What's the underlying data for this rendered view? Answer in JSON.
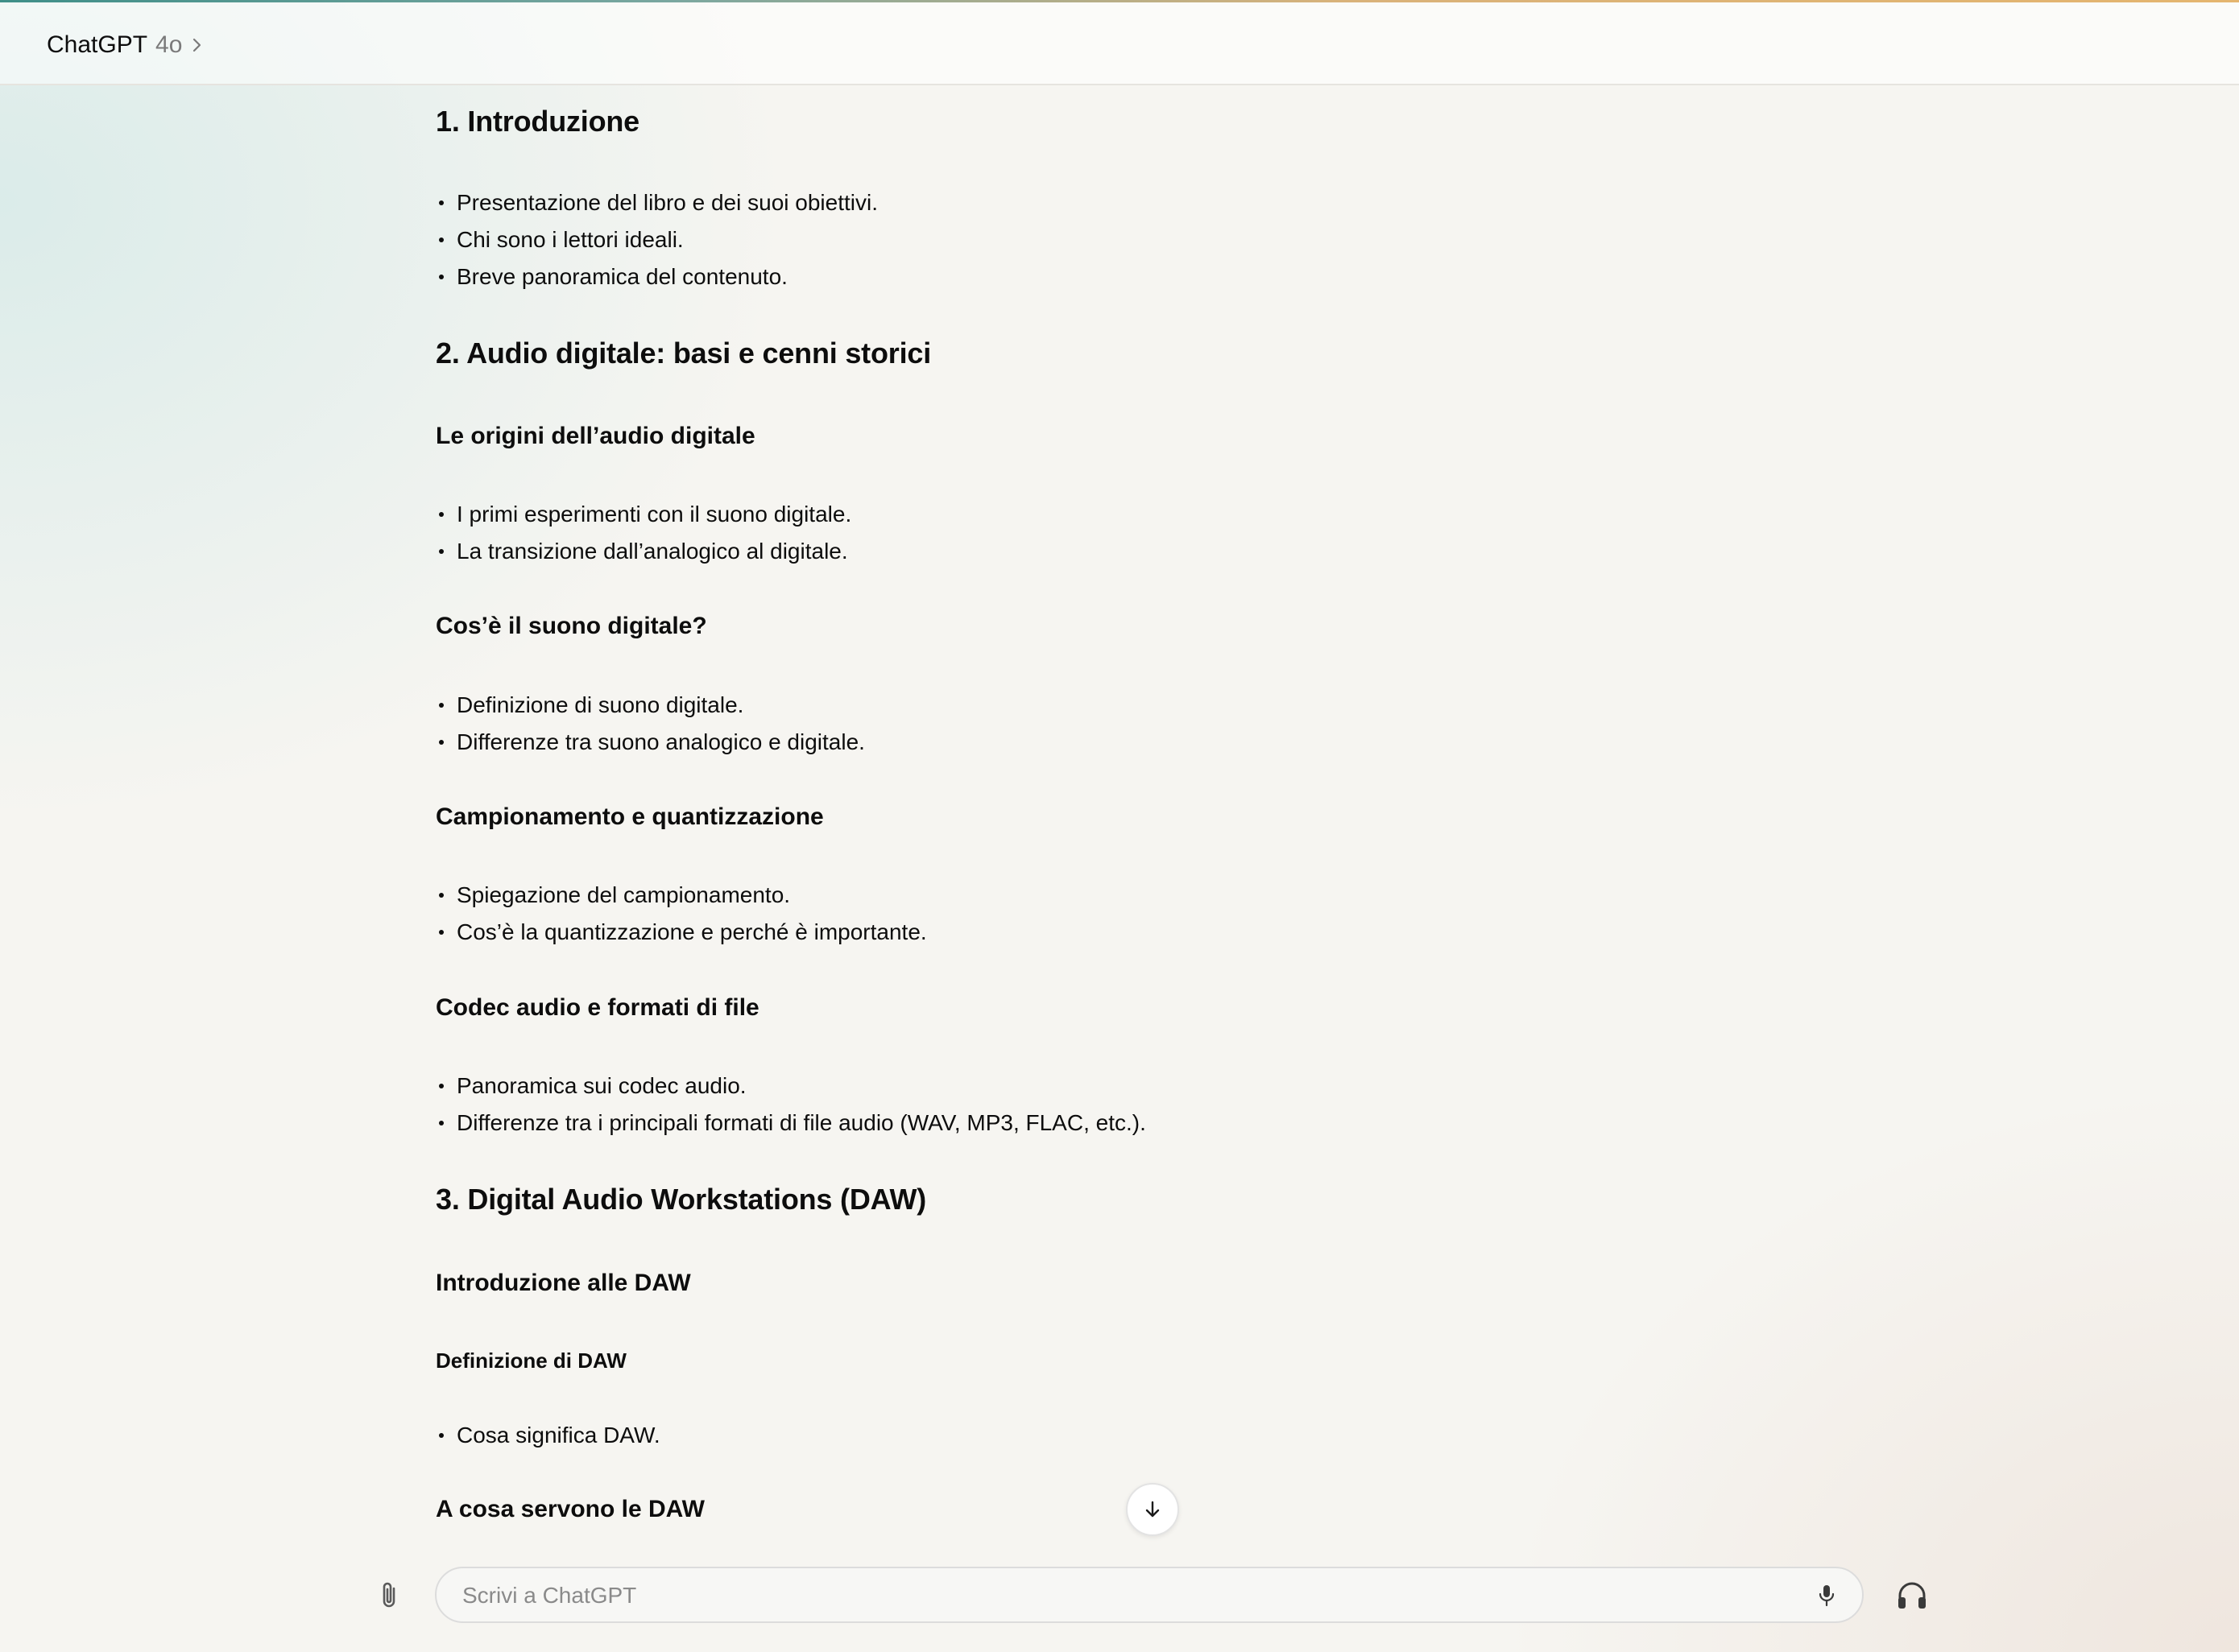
{
  "header": {
    "app_name": "ChatGPT",
    "model": "4o"
  },
  "content": {
    "s1_title": "1. Introduzione",
    "s1_items": [
      "Presentazione del libro e dei suoi obiettivi.",
      "Chi sono i lettori ideali.",
      "Breve panoramica del contenuto."
    ],
    "s2_title": "2. Audio digitale: basi e cenni storici",
    "s2a_title": "Le origini dell’audio digitale",
    "s2a_items": [
      "I primi esperimenti con il suono digitale.",
      "La transizione dall’analogico al digitale."
    ],
    "s2b_title": "Cos’è il suono digitale?",
    "s2b_items": [
      "Definizione di suono digitale.",
      "Differenze tra suono analogico e digitale."
    ],
    "s2c_title": "Campionamento e quantizzazione",
    "s2c_items": [
      "Spiegazione del campionamento.",
      "Cos’è la quantizzazione e perché è importante."
    ],
    "s2d_title": "Codec audio e formati di file",
    "s2d_items": [
      "Panoramica sui codec audio.",
      "Differenze tra i principali formati di file audio (WAV, MP3, FLAC, etc.)."
    ],
    "s3_title": "3. Digital Audio Workstations (DAW)",
    "s3a_title": "Introduzione alle DAW",
    "s3a1_title": "Definizione di DAW",
    "s3a1_items": [
      "Cosa significa DAW."
    ],
    "s3b_title": "A cosa servono le DAW"
  },
  "composer": {
    "placeholder": "Scrivi a ChatGPT"
  },
  "icons": {
    "model_switcher": "chevron-right-icon",
    "scroll": "arrow-down-icon",
    "attach": "paperclip-icon",
    "mic": "microphone-icon",
    "voice": "headphones-icon"
  }
}
